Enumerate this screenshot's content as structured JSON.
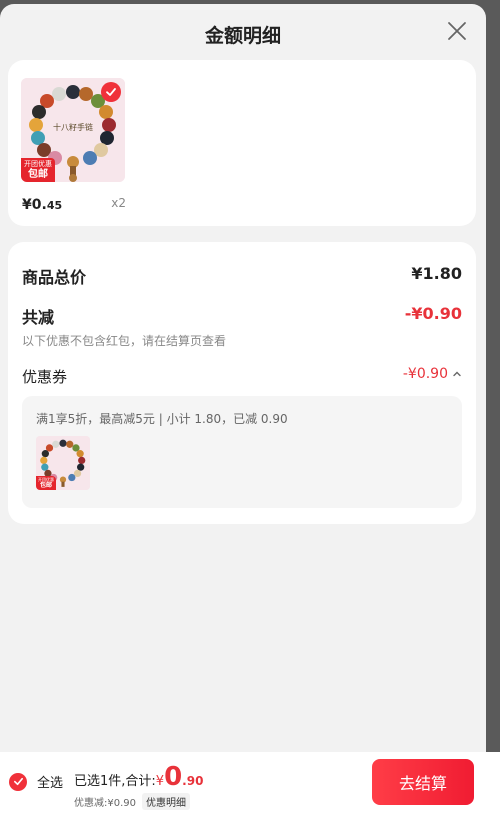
{
  "header": {
    "title": "金额明细"
  },
  "product": {
    "image_text": "十八籽手链",
    "tag_top": "开团优惠",
    "tag_main": "包邮",
    "price_symbol": "¥",
    "price_int": "0.",
    "price_dec": "45",
    "quantity": "x2"
  },
  "detail": {
    "total_label": "商品总价",
    "total_value": "¥1.80",
    "reduce_label": "共减",
    "reduce_value": "-¥0.90",
    "reduce_note": "以下优惠不包含红包，请在结算页查看",
    "coupon_label": "优惠券",
    "coupon_value": "-¥0.90",
    "coupon_desc": "满1享5折，最高减5元 | 小计 1.80，已减 0.90"
  },
  "bottom": {
    "select_all": "全选",
    "selected_text": "已选1件,合计:",
    "yen": "¥",
    "amount_int": "0",
    "amount_dec": ".90",
    "discount_text": "优惠减:¥0.90",
    "detail_link": "优惠明细",
    "checkout": "去结算"
  },
  "colors": {
    "accent": "#e8323a",
    "background": "#f2f2f2"
  }
}
